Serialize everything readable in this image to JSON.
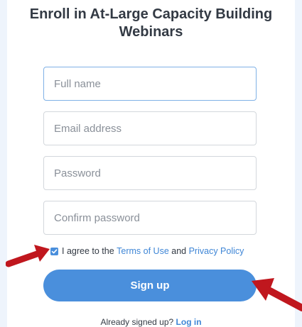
{
  "form": {
    "title": "Enroll in At-Large Capacity Building Webinars",
    "fields": [
      {
        "name": "full-name",
        "placeholder": "Full name",
        "value": ""
      },
      {
        "name": "email",
        "placeholder": "Email address",
        "value": ""
      },
      {
        "name": "password",
        "placeholder": "Password",
        "value": ""
      },
      {
        "name": "confirm-password",
        "placeholder": "Confirm password",
        "value": ""
      }
    ],
    "agree": {
      "checked": true,
      "text_before": "I agree to the ",
      "terms_label": "Terms of Use",
      "text_middle": " and ",
      "privacy_label": "Privacy Policy"
    },
    "signup_label": "Sign up",
    "login": {
      "prompt": "Already signed up? ",
      "link_label": "Log in"
    }
  },
  "colors": {
    "accent": "#4a8fdc",
    "link": "#3f86d6",
    "annotation_arrow": "#c0171e"
  },
  "annotations": {
    "arrows": [
      "checkbox-pointer-arrow",
      "signup-pointer-arrow"
    ]
  }
}
